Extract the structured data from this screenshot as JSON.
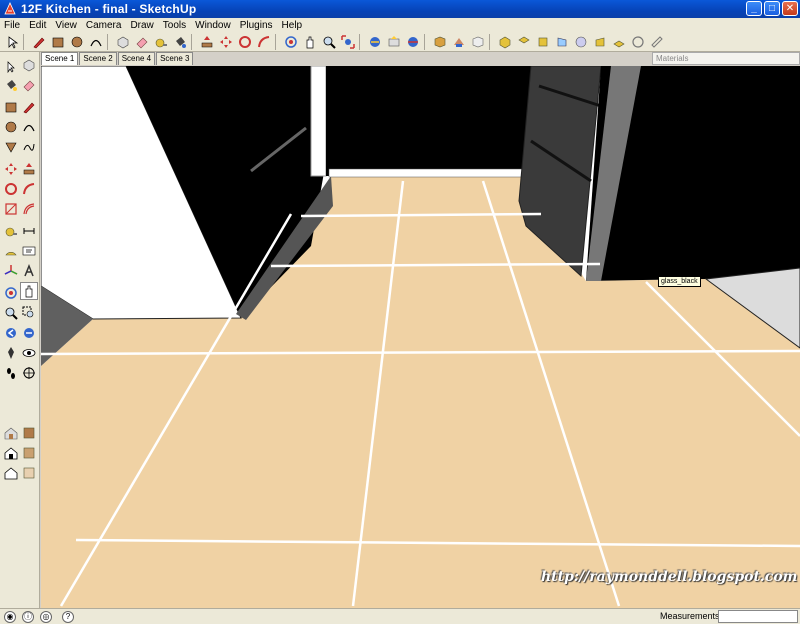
{
  "window": {
    "title": "12F Kitchen - final - SketchUp",
    "min_label": "_",
    "max_label": "□",
    "close_label": "✕"
  },
  "menu": {
    "items": [
      {
        "label": "File"
      },
      {
        "label": "Edit"
      },
      {
        "label": "View"
      },
      {
        "label": "Camera"
      },
      {
        "label": "Draw"
      },
      {
        "label": "Tools"
      },
      {
        "label": "Window"
      },
      {
        "label": "Plugins"
      },
      {
        "label": "Help"
      }
    ]
  },
  "toolbar": {
    "icons": [
      "select-icon",
      "pencil-icon",
      "rectangle-icon",
      "circle-icon",
      "arc-icon",
      "make-component-icon",
      "eraser-icon",
      "tape-measure-icon",
      "paint-bucket-icon",
      "push-pull-icon",
      "move-icon",
      "rotate-icon",
      "follow-me-icon",
      "orbit-icon",
      "pan-icon",
      "zoom-icon",
      "zoom-extents-icon",
      "get-models-icon",
      "share-model-icon",
      "section-icon",
      "components-icon",
      "materials-icon",
      "styles-icon",
      "iso-view-icon",
      "top-view-icon",
      "front-view-icon",
      "right-view-icon",
      "back-view-icon",
      "left-view-icon",
      "bottom-view-icon",
      "xray-icon"
    ]
  },
  "scenes": {
    "tabs": [
      {
        "label": "Scene 1",
        "active": true
      },
      {
        "label": "Scene 2",
        "active": false
      },
      {
        "label": "Scene 4",
        "active": false
      },
      {
        "label": "Scene 3",
        "active": false
      }
    ]
  },
  "materials_panel": {
    "title": "Materials"
  },
  "viewport": {
    "tooltip": "glass_black",
    "watermark": "http://raymonddell.blogspot.com"
  },
  "statusbar": {
    "measurements_label": "Measurements",
    "help_icon": "?"
  },
  "colors": {
    "floor": "#f0d2a4",
    "grout": "#ffffff",
    "cabinet": "#000000",
    "titlebar": "#0a58d8"
  }
}
